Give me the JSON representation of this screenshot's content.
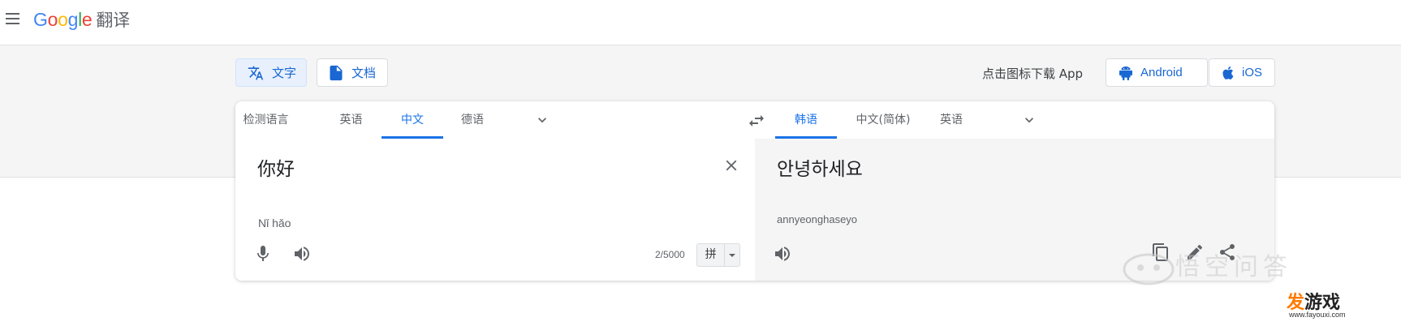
{
  "header": {
    "logo_letters": [
      "G",
      "o",
      "o",
      "g",
      "l",
      "e"
    ],
    "product": "翻译"
  },
  "modes": {
    "text_label": "文字",
    "doc_label": "文档"
  },
  "download": {
    "label": "点击图标下载 App",
    "android": "Android",
    "ios": "iOS"
  },
  "source": {
    "tabs": [
      "检测语言",
      "英语",
      "中文",
      "德语"
    ],
    "active_tab": "中文",
    "text": "你好",
    "romanization": "Nǐ hǎo",
    "char_count": "2/5000",
    "ime_label": "拼"
  },
  "target": {
    "tabs": [
      "韩语",
      "中文(简体)",
      "英语"
    ],
    "active_tab": "韩语",
    "text": "안녕하세요",
    "romanization": "annyeonghaseyo"
  },
  "watermark": {
    "text": "悟空问答",
    "brand_a": "发",
    "brand_b": "游戏",
    "url": "www.fayouxi.com"
  },
  "colors": {
    "accent": "#1a73e8",
    "band": "#f5f5f5"
  }
}
